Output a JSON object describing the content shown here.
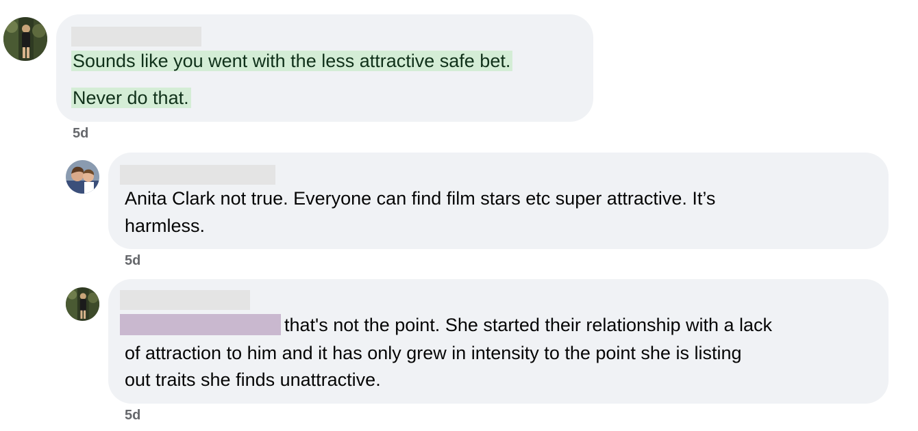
{
  "comments": [
    {
      "author_redacted": true,
      "lines": [
        "Sounds like you went with the less attractive safe bet.",
        "Never do that."
      ],
      "highlighted": true,
      "timestamp": "5d"
    },
    {
      "author_redacted": true,
      "lines": [
        "Anita Clark not true. Everyone can find film stars etc super attractive. It’s",
        "harmless."
      ],
      "timestamp": "5d"
    },
    {
      "author_redacted": true,
      "mention_redacted": true,
      "lines": [
        "that's not the point. She started their relationship with a lack",
        "of attraction to him and it has only grew in intensity to the point she is listing",
        "out traits she finds unattractive."
      ],
      "timestamp": "5d"
    }
  ],
  "colors": {
    "bubble": "#f0f2f5",
    "text": "#050505",
    "timestamp": "#65676b",
    "highlight": "#d4edd6",
    "name_redaction": "#e4e4e4",
    "mention_redaction": "#c9b8cf"
  },
  "icons": [
    "avatar-forest-photo",
    "avatar-couple-photo"
  ]
}
